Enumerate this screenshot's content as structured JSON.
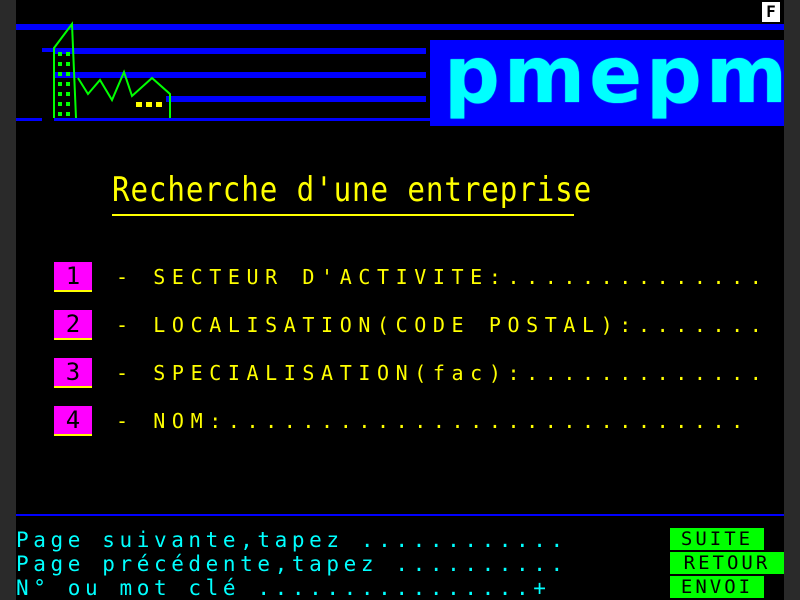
{
  "header": {
    "corner_label": "F",
    "logo": "pmepmi"
  },
  "title": "Recherche d'une entreprise",
  "menu": [
    {
      "number": "1",
      "label": "- SECTEUR D'ACTIVITE:.............."
    },
    {
      "number": "2",
      "label": "- LOCALISATION(CODE POSTAL):......."
    },
    {
      "number": "3",
      "label": "- SPECIALISATION(fac):............."
    },
    {
      "number": "4",
      "label": "- NOM:............................"
    }
  ],
  "footer": {
    "lines": [
      {
        "text": "Page suivante,tapez ............",
        "key": "SUITE"
      },
      {
        "text": "Page précédente,tapez ..........",
        "key": "RETOUR"
      },
      {
        "text": "N° ou mot clé ................+",
        "key": "ENVOI"
      }
    ]
  },
  "colors": {
    "background": "#000000",
    "stripes": "#0000ff",
    "logo": "#00ffff",
    "text": "#ffff00",
    "key_badges": "#ff00ff",
    "footer_text": "#00ffff",
    "function_keys": "#00ff00"
  }
}
